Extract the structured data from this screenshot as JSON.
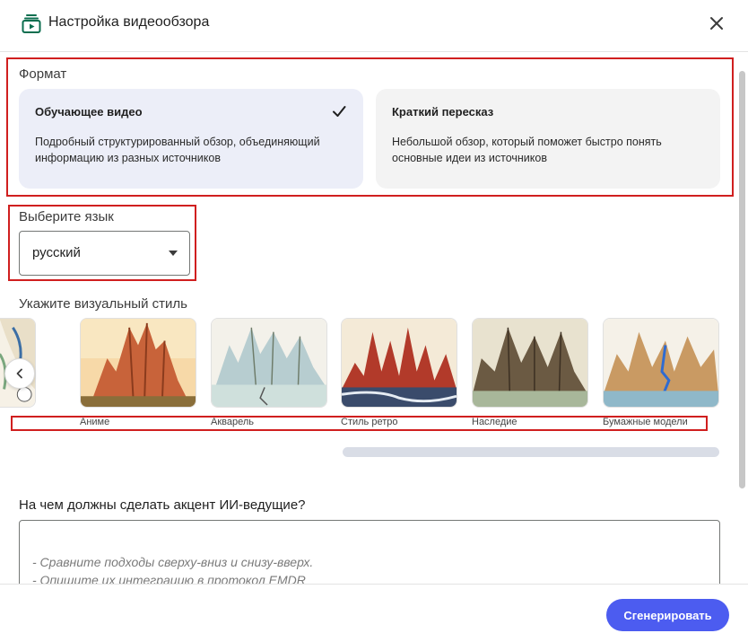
{
  "header": {
    "title": "Настройка видеообзора",
    "icon": "video-overview-icon",
    "close_icon": "close-icon"
  },
  "format": {
    "label": "Формат",
    "options": [
      {
        "title": "Обучающее видео",
        "description_line1": "Подробный структурированный обзор, объединяющий",
        "description_line2": "информацию из разных источников",
        "selected": true
      },
      {
        "title": "Краткий пересказ",
        "description_line1": "Небольшой обзор, который поможет быстро понять",
        "description_line2": "основные идеи из источников",
        "selected": false
      }
    ]
  },
  "language": {
    "label": "Выберите язык",
    "value": "русский"
  },
  "visual_style": {
    "label": "Укажите визуальный стиль",
    "styles": [
      {
        "label": "Аниме"
      },
      {
        "label": "Акварель"
      },
      {
        "label": "Стиль ретро"
      },
      {
        "label": "Наследие"
      },
      {
        "label": "Бумажные модели"
      }
    ]
  },
  "focus": {
    "label": "На чем должны сделать акцент ИИ-ведущие?",
    "placeholder_line1": "- Сравните подходы сверху-вниз и снизу-вверх.",
    "placeholder_line2": "- Опишите их интеграцию в протокол EMDR"
  },
  "footer": {
    "generate_label": "Сгенерировать"
  },
  "colors": {
    "accent": "#4c5cf0",
    "selected_card": "#eceef8",
    "highlight_border": "#d01f1f"
  }
}
